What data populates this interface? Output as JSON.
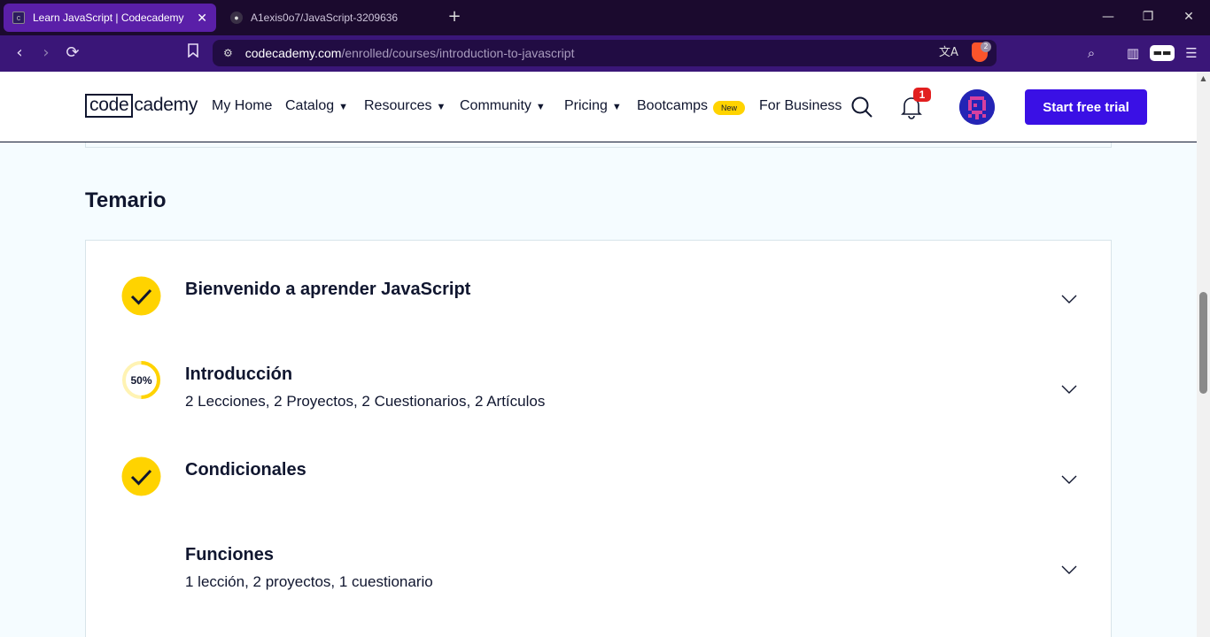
{
  "browser": {
    "tabs": [
      {
        "title": "Learn JavaScript | Codecademy",
        "active": true
      },
      {
        "title": "A1exis0o7/JavaScript-3209636",
        "active": false
      }
    ],
    "new_tab": "+",
    "close_symbol": "✕",
    "url_host": "codecademy.com",
    "url_path": "/enrolled/courses/introduction-to-javascript",
    "shield_count": "2",
    "window_controls": {
      "minimize": "—",
      "restore": "❐",
      "close": "✕"
    }
  },
  "header": {
    "logo_code": "code",
    "logo_academy": "cademy",
    "nav": [
      {
        "label": "My Home",
        "dropdown": false
      },
      {
        "label": "Catalog",
        "dropdown": true
      },
      {
        "label": "Resources",
        "dropdown": true
      },
      {
        "label": "Community",
        "dropdown": true
      },
      {
        "label": "Pricing",
        "dropdown": true
      },
      {
        "label": "Bootcamps",
        "dropdown": false
      },
      {
        "label": "For Business",
        "dropdown": false
      }
    ],
    "caret": "▼",
    "new_badge": "New",
    "notification_count": "1",
    "cta": "Start free trial"
  },
  "syllabus": {
    "title": "Temario",
    "modules": [
      {
        "title": "Bienvenido a aprender JavaScript",
        "subtitle": "",
        "status": "complete"
      },
      {
        "title": "Introducción",
        "subtitle": "2 Lecciones, 2 Proyectos, 2 Cuestionarios, 2 Artículos",
        "status": "in-progress",
        "progress_label": "50%",
        "progress": 0.5
      },
      {
        "title": "Condicionales",
        "subtitle": "",
        "status": "complete"
      },
      {
        "title": "Funciones",
        "subtitle": "1 lección, 2 proyectos, 1 cuestionario",
        "status": "not-started"
      }
    ]
  },
  "colors": {
    "accent": "#3a10e5",
    "check_yellow": "#ffd300",
    "navy": "#10162f",
    "browser_purple": "#3a1678"
  }
}
